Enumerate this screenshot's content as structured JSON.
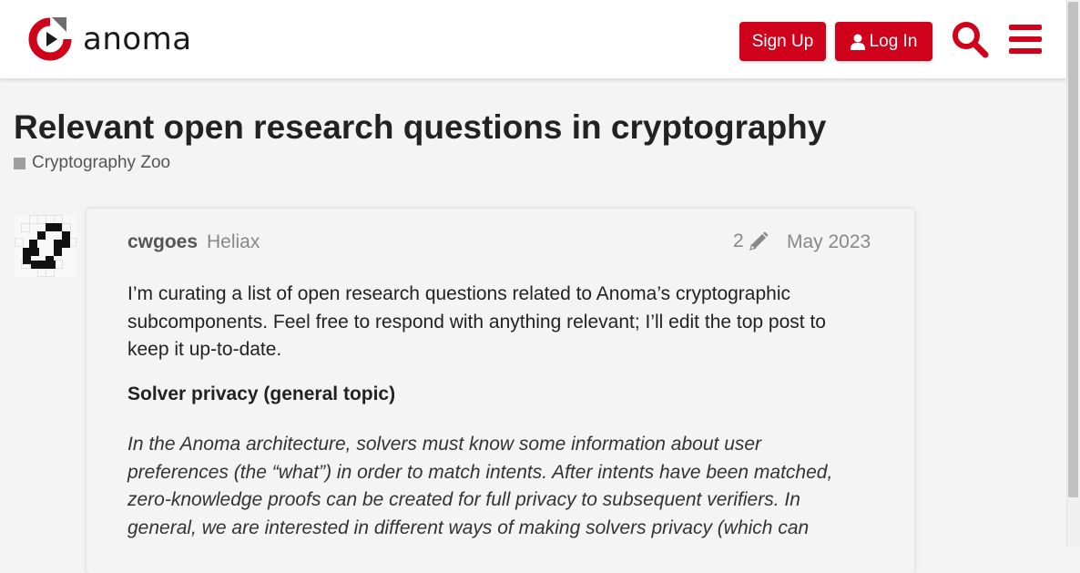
{
  "header": {
    "logo_text": "anoma",
    "signup_label": "Sign Up",
    "login_label": "Log In",
    "search_icon": "search-icon",
    "menu_icon": "hamburger-menu-icon"
  },
  "colors": {
    "accent": "#d0021b",
    "category": "#9e9e9e",
    "background": "#f4f4f4"
  },
  "topic": {
    "title": "Relevant open research questions in cryptography",
    "category": "Cryptography Zoo"
  },
  "post": {
    "username": "cwgoes",
    "user_group": "Heliax",
    "edit_count": "2",
    "date": "May 2023",
    "paragraph1": "I’m curating a list of open research questions related to Anoma’s cryptographic subcomponents. Feel free to respond with anything relevant; I’ll edit the top post to keep it up-to-date.",
    "heading": "Solver privacy (general topic)",
    "paragraph2": "In the Anoma architecture, solvers must know some information about user preferences (the “what”) in order to match intents. After intents have been matched, zero-knowledge proofs can be created for full privacy to subsequent verifiers. In general, we are interested in different ways of making solvers privacy (which can"
  }
}
